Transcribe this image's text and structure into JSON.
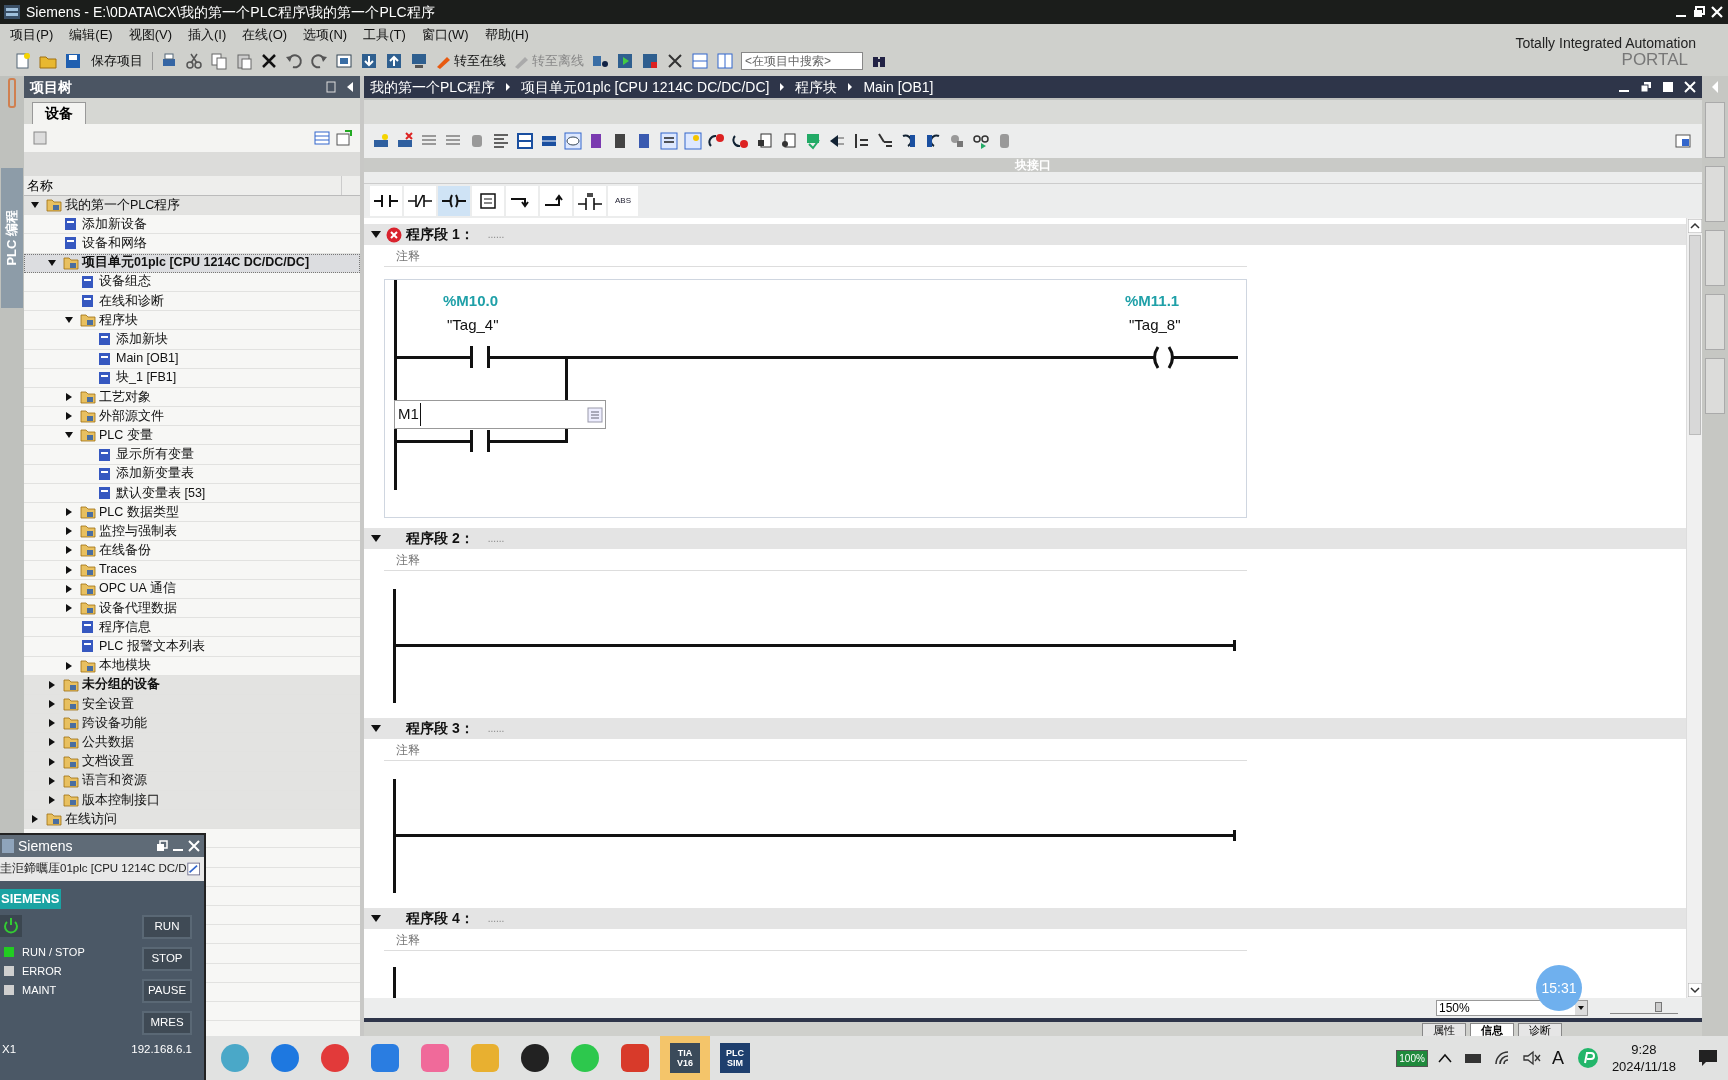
{
  "title_bar": {
    "title": "Siemens  -  E:\\0DATA\\CX\\我的第一个PLC程序\\我的第一个PLC程序"
  },
  "menu": [
    "项目(P)",
    "编辑(E)",
    "视图(V)",
    "插入(I)",
    "在线(O)",
    "选项(N)",
    "工具(T)",
    "窗口(W)",
    "帮助(H)"
  ],
  "toolbar": {
    "save_label": "保存项目",
    "go_online": {
      "label": "转至在线",
      "disabled": false
    },
    "go_offline": {
      "label": "转至离线",
      "disabled": true
    },
    "search": {
      "placeholder": "<在项目中搜索>"
    }
  },
  "brand": {
    "line1": "Totally Integrated Automation",
    "line2": "PORTAL"
  },
  "side_tab": "PLC 编程",
  "project_tree": {
    "title": "项目树",
    "tab": "设备",
    "column": "名称",
    "items": [
      {
        "label": "我的第一个PLC程序",
        "kind": "folder",
        "expanded": true,
        "bold": false,
        "selected": false,
        "children": [
          {
            "label": "添加新设备",
            "kind": "leaf",
            "bold": false,
            "selected": false
          },
          {
            "label": "设备和网络",
            "kind": "leaf",
            "bold": false,
            "selected": false
          },
          {
            "label": "项目单元01plc [CPU 1214C DC/DC/DC]",
            "kind": "folder",
            "expanded": true,
            "bold": true,
            "selected": true,
            "children": [
              {
                "label": "设备组态",
                "kind": "leaf",
                "bold": false,
                "selected": false
              },
              {
                "label": "在线和诊断",
                "kind": "leaf",
                "bold": false,
                "selected": false
              },
              {
                "label": "程序块",
                "kind": "folder",
                "expanded": true,
                "bold": false,
                "selected": false,
                "children": [
                  {
                    "label": "添加新块",
                    "kind": "leaf",
                    "bold": false,
                    "selected": false
                  },
                  {
                    "label": "Main [OB1]",
                    "kind": "leaf",
                    "bold": false,
                    "selected": false
                  },
                  {
                    "label": "块_1 [FB1]",
                    "kind": "leaf",
                    "bold": false,
                    "selected": false
                  }
                ]
              },
              {
                "label": "工艺对象",
                "kind": "folder",
                "expanded": false,
                "bold": false,
                "selected": false
              },
              {
                "label": "外部源文件",
                "kind": "folder",
                "expanded": false,
                "bold": false,
                "selected": false
              },
              {
                "label": "PLC 变量",
                "kind": "folder",
                "expanded": true,
                "bold": false,
                "selected": false,
                "children": [
                  {
                    "label": "显示所有变量",
                    "kind": "leaf",
                    "bold": false,
                    "selected": false
                  },
                  {
                    "label": "添加新变量表",
                    "kind": "leaf",
                    "bold": false,
                    "selected": false
                  },
                  {
                    "label": "默认变量表 [53]",
                    "kind": "leaf",
                    "bold": false,
                    "selected": false
                  }
                ]
              },
              {
                "label": "PLC 数据类型",
                "kind": "folder",
                "expanded": false,
                "bold": false,
                "selected": false
              },
              {
                "label": "监控与强制表",
                "kind": "folder",
                "expanded": false,
                "bold": false,
                "selected": false
              },
              {
                "label": "在线备份",
                "kind": "folder",
                "expanded": false,
                "bold": false,
                "selected": false
              },
              {
                "label": "Traces",
                "kind": "folder",
                "expanded": false,
                "bold": false,
                "selected": false
              },
              {
                "label": "OPC UA 通信",
                "kind": "folder",
                "expanded": false,
                "bold": false,
                "selected": false
              },
              {
                "label": "设备代理数据",
                "kind": "folder",
                "expanded": false,
                "bold": false,
                "selected": false
              },
              {
                "label": "程序信息",
                "kind": "leaf",
                "bold": false,
                "selected": false
              },
              {
                "label": "PLC 报警文本列表",
                "kind": "leaf",
                "bold": false,
                "selected": false
              },
              {
                "label": "本地模块",
                "kind": "folder",
                "expanded": false,
                "bold": false,
                "selected": false
              }
            ]
          },
          {
            "label": "未分组的设备",
            "kind": "folder",
            "expanded": false,
            "bold": true,
            "selected": false
          },
          {
            "label": "安全设置",
            "kind": "folder",
            "expanded": false,
            "bold": false,
            "selected": false
          },
          {
            "label": "跨设备功能",
            "kind": "folder",
            "expanded": false,
            "bold": false,
            "selected": false
          },
          {
            "label": "公共数据",
            "kind": "folder",
            "expanded": false,
            "bold": false,
            "selected": false
          },
          {
            "label": "文档设置",
            "kind": "folder",
            "expanded": false,
            "bold": false,
            "selected": false
          },
          {
            "label": "语言和资源",
            "kind": "folder",
            "expanded": false,
            "bold": false,
            "selected": false
          },
          {
            "label": "版本控制接口",
            "kind": "folder",
            "expanded": false,
            "bold": false,
            "selected": false
          }
        ]
      },
      {
        "label": "在线访问",
        "kind": "folder",
        "expanded": false,
        "bold": false,
        "selected": false
      }
    ]
  },
  "editor": {
    "breadcrumb": [
      "我的第一个PLC程序",
      "项目单元01plc [CPU 1214C DC/DC/DC]",
      "程序块",
      "Main [OB1]"
    ],
    "interface_label": "块接口",
    "palette": [
      {
        "kind": "contact",
        "selected": false
      },
      {
        "kind": "negated-contact",
        "selected": false
      },
      {
        "kind": "coil",
        "selected": true
      },
      {
        "kind": "empty-box",
        "selected": false
      },
      {
        "kind": "open-branch",
        "selected": false
      },
      {
        "kind": "close-branch",
        "selected": false
      },
      {
        "kind": "compare",
        "selected": false
      },
      {
        "kind": "text",
        "label": "ABS",
        "selected": false
      }
    ],
    "networks": [
      {
        "title": "程序段 1：",
        "dots": "......",
        "comment": "注释",
        "error": true,
        "expanded": true,
        "kind": "contact-coil",
        "contact": {
          "address": "%M10.0",
          "tag": "\"Tag_4\""
        },
        "coil": {
          "address": "%M11.1",
          "tag": "\"Tag_8\""
        },
        "branch_input": {
          "value": "M1"
        }
      },
      {
        "title": "程序段 2：",
        "dots": "......",
        "comment": "注释",
        "error": false,
        "expanded": true,
        "kind": "empty"
      },
      {
        "title": "程序段 3：",
        "dots": "......",
        "comment": "注释",
        "error": false,
        "expanded": true,
        "kind": "empty"
      },
      {
        "title": "程序段 4：",
        "dots": "......",
        "comment": "注释",
        "error": false,
        "expanded": true,
        "kind": "stub"
      }
    ],
    "zoom": {
      "value": "150%"
    },
    "zoom_slider": {
      "level": 0.7
    },
    "bottom_tabs": [
      {
        "label": "属性",
        "selected": false
      },
      {
        "label": "信息",
        "selected": true
      },
      {
        "label": "诊断",
        "selected": false
      }
    ]
  },
  "recorder_badge": "15:31",
  "plcsim": {
    "title": "Siemens",
    "device": "圭洰鍗曞厓01plc [CPU 1214C DC/D",
    "logo": "SIEMENS",
    "leds": [
      {
        "label": "RUN / STOP",
        "on": true
      },
      {
        "label": "ERROR",
        "on": false
      },
      {
        "label": "MAINT",
        "on": false
      }
    ],
    "buttons": [
      "RUN",
      "STOP",
      "PAUSE",
      "MRES"
    ],
    "slot": "X1",
    "ip": "192.168.6.1"
  },
  "taskbar": {
    "apps": [
      {
        "kind": "round",
        "color": "#4aa8c8"
      },
      {
        "kind": "round",
        "color": "#1e78e0"
      },
      {
        "kind": "round",
        "color": "#e23a3a"
      },
      {
        "kind": "square",
        "color": "#2a7de1"
      },
      {
        "kind": "square",
        "color": "#f06a9a"
      },
      {
        "kind": "square",
        "color": "#e8b030"
      },
      {
        "kind": "round",
        "color": "#222222"
      },
      {
        "kind": "round",
        "color": "#2dc84d"
      },
      {
        "kind": "square",
        "color": "#d83a2a"
      },
      {
        "kind": "labeled",
        "color": "#3a4a5a",
        "label": "TIA V16",
        "selected": true
      },
      {
        "kind": "labeled",
        "color": "#1e3f6e",
        "label": "PLC SIM",
        "selected": false
      }
    ],
    "battery": "100%",
    "ime": "A",
    "time": "9:28",
    "date": "2024/11/18"
  }
}
